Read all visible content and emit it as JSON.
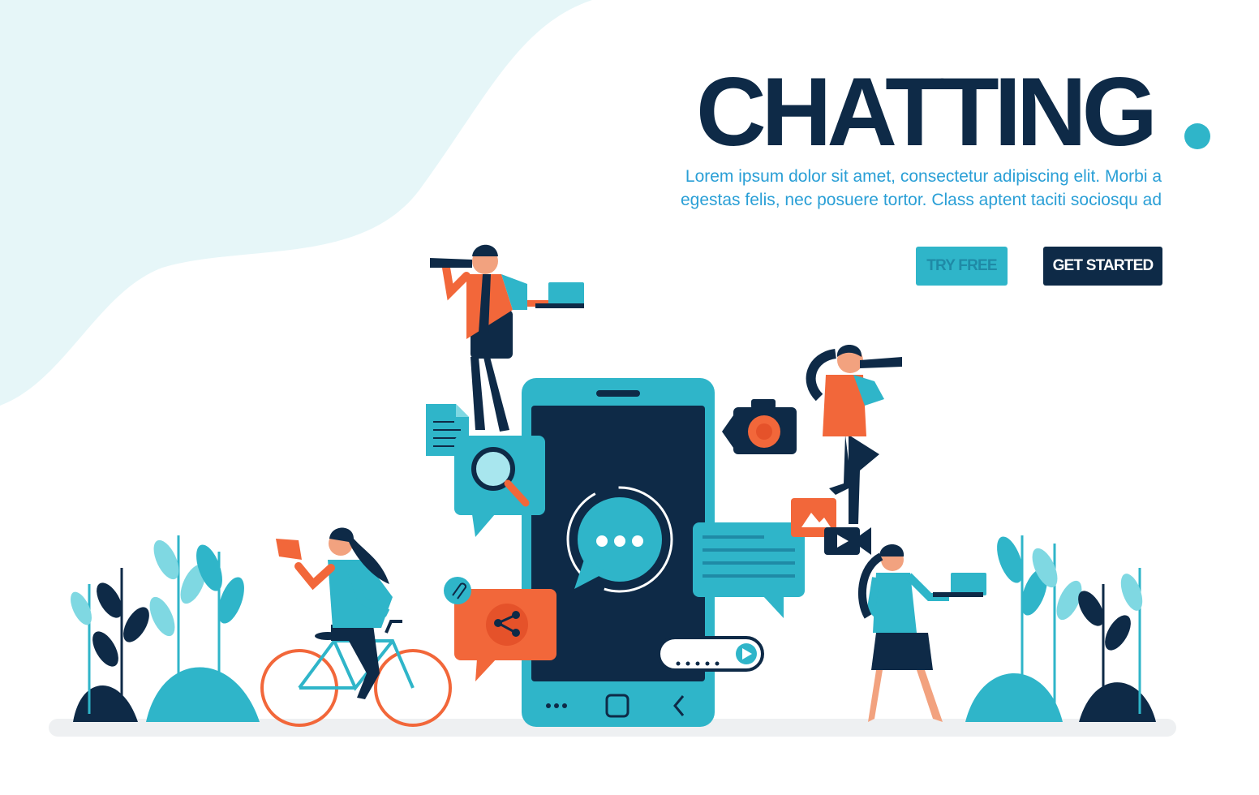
{
  "hero": {
    "title": "CHATTING",
    "description": "Lorem ipsum dolor sit amet, consectetur adipiscing elit. Morbi a egestas felis, nec posuere tortor. Class aptent taciti sociosqu ad"
  },
  "buttons": {
    "try_free": "TRY FREE",
    "get_started": "GET STARTED"
  },
  "colors": {
    "navy": "#0e2a47",
    "teal": "#2fb5c9",
    "accent_orange": "#f2673a",
    "link_blue": "#2a9fd6"
  },
  "icons": [
    "chat-bubble-icon",
    "search-icon",
    "camera-icon",
    "image-icon",
    "video-camera-icon",
    "share-icon",
    "attachment-icon",
    "send-icon",
    "document-icon"
  ]
}
